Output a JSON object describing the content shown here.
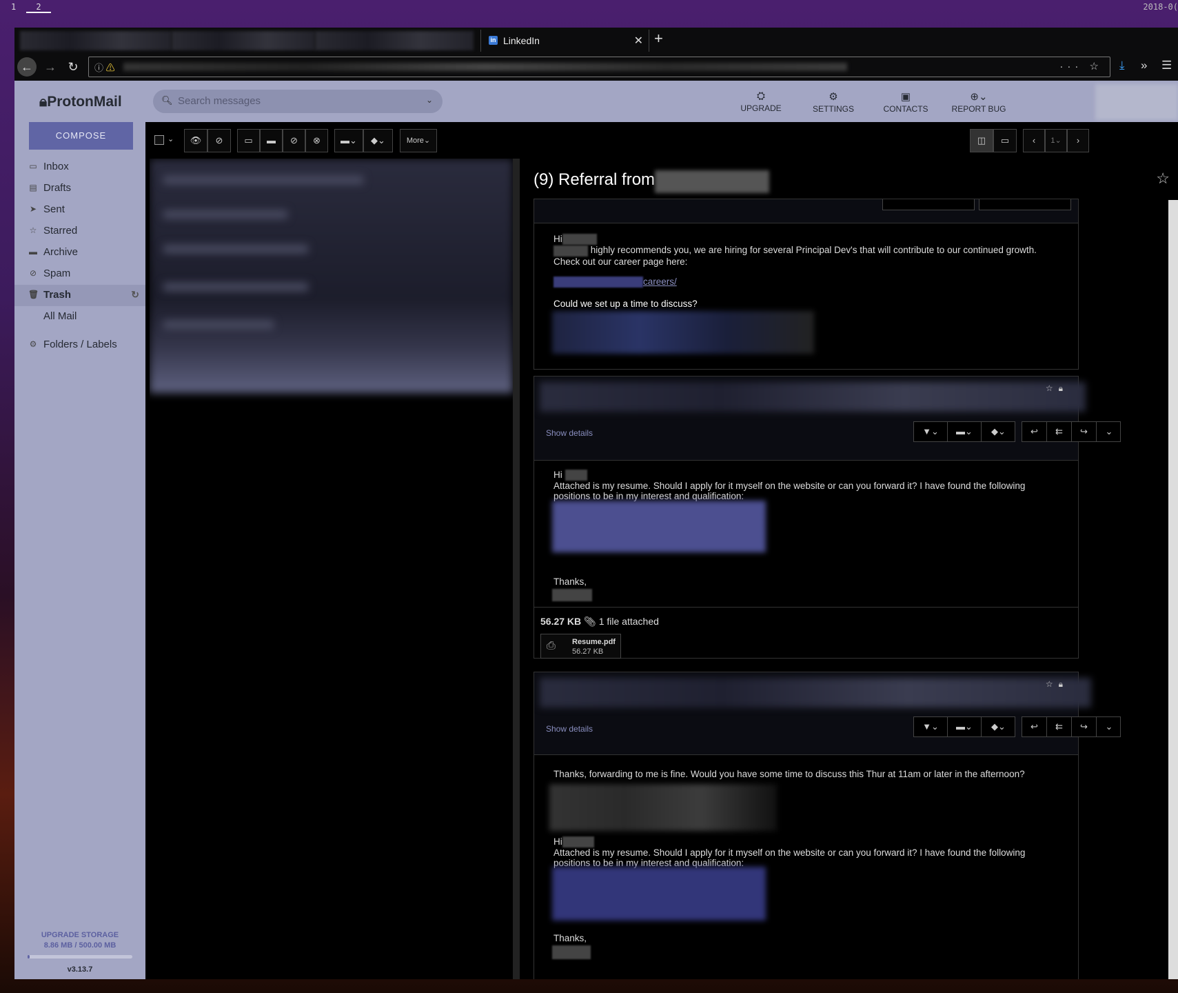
{
  "workspaces": [
    "1",
    "2"
  ],
  "clock": "2018-0(",
  "browser": {
    "active_tab": "LinkedIn",
    "tab_icon": "in",
    "new_tab": "+"
  },
  "app": {
    "logo": "ProtonMail",
    "compose": "COMPOSE",
    "folders": [
      {
        "label": "Inbox",
        "icon": "inbox-icon"
      },
      {
        "label": "Drafts",
        "icon": "file-icon"
      },
      {
        "label": "Sent",
        "icon": "paper-plane-icon"
      },
      {
        "label": "Starred",
        "icon": "star-icon"
      },
      {
        "label": "Archive",
        "icon": "archive-icon"
      },
      {
        "label": "Spam",
        "icon": "ban-icon"
      },
      {
        "label": "Trash",
        "icon": "trash-icon"
      },
      {
        "label": "All Mail",
        "icon": ""
      },
      {
        "label": "Folders / Labels",
        "icon": "gear-icon"
      }
    ],
    "storage": {
      "label": "UPGRADE STORAGE",
      "usage": "8.86 MB / 500.00 MB",
      "fraction": 0.0177
    },
    "version": "v3.13.7",
    "search_placeholder": "Search messages",
    "top_nav": [
      {
        "label": "UPGRADE",
        "icon": "upgrade-icon"
      },
      {
        "label": "SETTINGS",
        "icon": "settings-icon"
      },
      {
        "label": "CONTACTS",
        "icon": "contacts-icon"
      },
      {
        "label": "REPORT BUG",
        "icon": "bug-icon"
      }
    ],
    "toolbar": {
      "more": "More",
      "page": "1"
    },
    "conversation": {
      "title": "(9) Referral from",
      "show_details": "Show details",
      "message1": {
        "greeting": "Hi",
        "body": "highly recommends you, we are hiring for several Principal Dev's that will contribute to our continued growth.  Check out our career page here:",
        "link": "careers/",
        "question": "Could we set up a time to discuss?"
      },
      "message2": {
        "greeting": "Hi",
        "body": "Attached is my resume. Should I apply for it myself on the website or can you forward it? I have found the following positions to be in my interest and qualification:",
        "thanks": "Thanks,",
        "attach_size": "56.27 KB",
        "attach_count": "1 file attached",
        "file_name": "Resume.pdf",
        "file_size": "56.27 KB"
      },
      "message3": {
        "body": "Thanks, forwarding to me is fine.  Would you have some time to discuss this Thur at 11am or later in the afternoon?",
        "greeting": "Hi",
        "quoted": "Attached is my resume. Should I apply for it myself on the website or can you forward it? I have found the following positions to be in my interest and qualification:",
        "thanks": "Thanks,"
      }
    }
  }
}
